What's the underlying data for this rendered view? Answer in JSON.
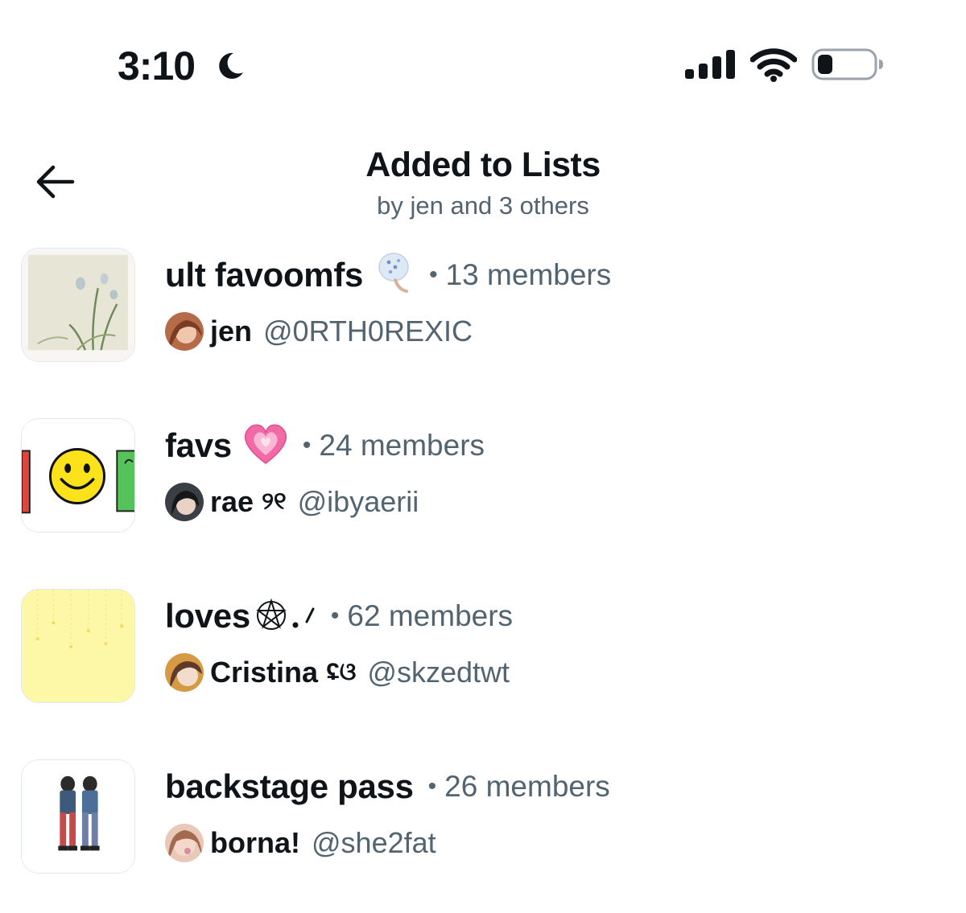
{
  "status_bar": {
    "time": "3:10",
    "icons": [
      "moon-icon",
      "cellular-signal-icon",
      "wifi-icon",
      "battery-icon"
    ]
  },
  "header": {
    "title": "Added to Lists",
    "subtitle": "by jen and 3 others",
    "back_icon": "arrow-left-icon"
  },
  "lists": [
    {
      "name": "ult favoomfs",
      "emoji_icon": "hand-fan-sticker-icon",
      "separator": "•",
      "members": "13 members",
      "owner_name": "jen",
      "owner_decoration": "",
      "owner_handle": "@0RTH0REXIC"
    },
    {
      "name": "favs",
      "emoji_icon": "growing-heart-icon",
      "separator": "•",
      "members": "24 members",
      "owner_name": "rae",
      "owner_decoration": "୨୧",
      "owner_handle": "@ibyaerii"
    },
    {
      "name": "loves",
      "emoji_icon": "pentagram-sparkle-icon",
      "separator": "•",
      "members": "62 members",
      "owner_name": "Cristina",
      "owner_decoration": "ʢଓ",
      "owner_handle": "@skzedtwt"
    },
    {
      "name": "backstage pass",
      "emoji_icon": "",
      "separator": "•",
      "members": "26 members",
      "owner_name": "borna!",
      "owner_decoration": "",
      "owner_handle": "@she2fat"
    }
  ],
  "colors": {
    "primary_text": "#0f1419",
    "secondary_text": "#536471",
    "heart": "#f06aa6",
    "thumb_yellow": "#fdf7a8"
  }
}
